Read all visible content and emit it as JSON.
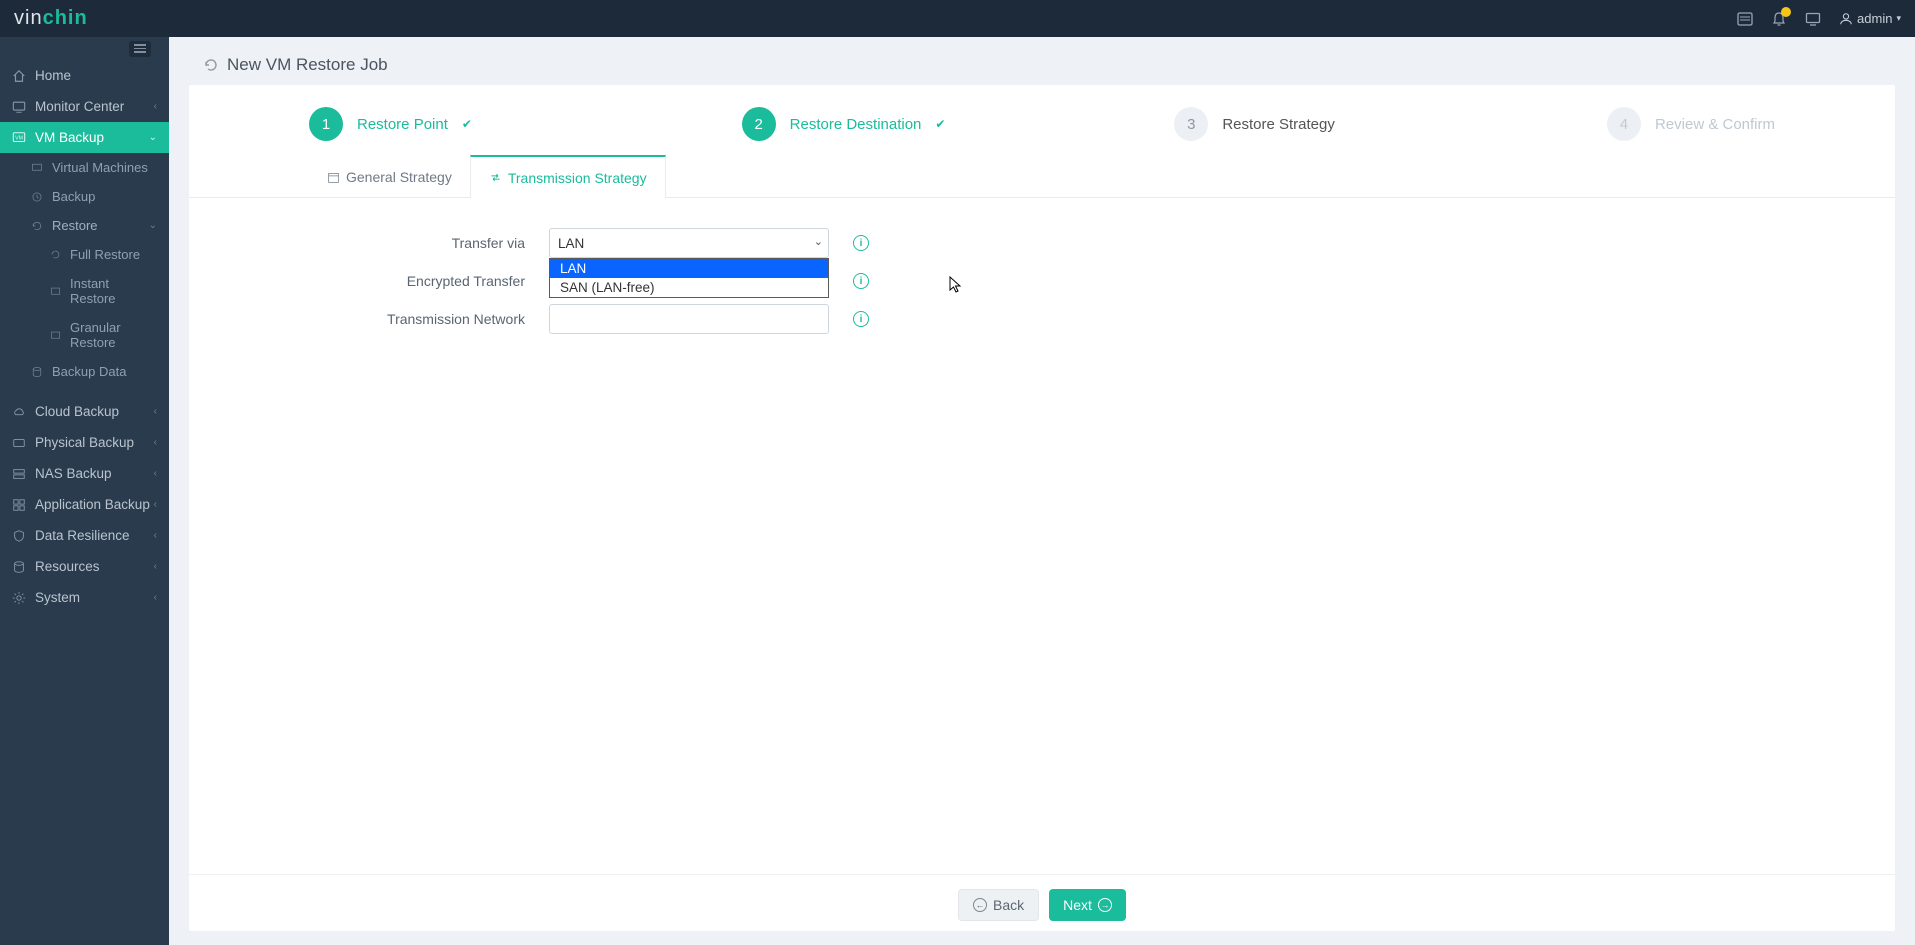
{
  "app": {
    "logo_prefix": "vin",
    "logo_suffix": "chin",
    "user": "admin"
  },
  "sidebar": {
    "home": "Home",
    "monitor": "Monitor Center",
    "vm_backup": "VM Backup",
    "virtual_machines": "Virtual Machines",
    "backup": "Backup",
    "restore": "Restore",
    "full_restore": "Full Restore",
    "instant_restore": "Instant Restore",
    "granular_restore": "Granular Restore",
    "backup_data": "Backup Data",
    "cloud_backup": "Cloud Backup",
    "physical_backup": "Physical Backup",
    "nas_backup": "NAS Backup",
    "application_backup": "Application Backup",
    "data_resilience": "Data Resilience",
    "resources": "Resources",
    "system": "System"
  },
  "page": {
    "title": "New VM Restore Job"
  },
  "stepper": {
    "steps": [
      {
        "num": "1",
        "label": "Restore Point",
        "state": "done"
      },
      {
        "num": "2",
        "label": "Restore Destination",
        "state": "done"
      },
      {
        "num": "3",
        "label": "Restore Strategy",
        "state": "current"
      },
      {
        "num": "4",
        "label": "Review & Confirm",
        "state": "pending"
      }
    ]
  },
  "tabs": {
    "general": "General Strategy",
    "transmission": "Transmission Strategy"
  },
  "form": {
    "transfer_via_label": "Transfer via",
    "transfer_via_value": "LAN",
    "transfer_via_options": [
      "LAN",
      "SAN (LAN-free)"
    ],
    "encrypted_label": "Encrypted Transfer",
    "network_label": "Transmission Network"
  },
  "footer": {
    "back": "Back",
    "next": "Next"
  }
}
